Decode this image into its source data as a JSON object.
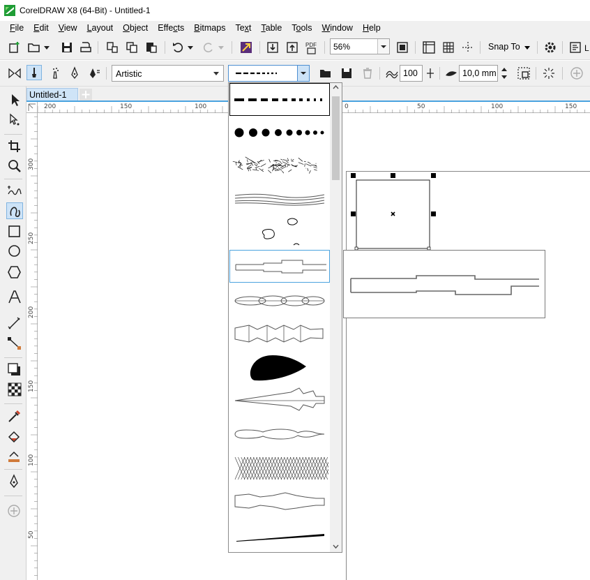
{
  "window": {
    "title": "CorelDRAW X8 (64-Bit) - Untitled-1",
    "brand_color": "#1f9d35"
  },
  "menu": {
    "items": [
      {
        "label": "File",
        "key": "F",
        "rest": "ile"
      },
      {
        "label": "Edit",
        "key": "E",
        "rest": "dit"
      },
      {
        "label": "View",
        "key": "V",
        "rest": "iew"
      },
      {
        "label": "Layout",
        "key": "L",
        "rest": "ayout"
      },
      {
        "label": "Object",
        "key": "O",
        "rest": "bject"
      },
      {
        "label": "Effects",
        "pre": "Effe",
        "key": "c",
        "rest": "ts"
      },
      {
        "label": "Bitmaps",
        "key": "B",
        "rest": "itmaps"
      },
      {
        "label": "Text",
        "pre": "Te",
        "key": "x",
        "rest": "t"
      },
      {
        "label": "Table",
        "key": "T",
        "rest": "able"
      },
      {
        "label": "Tools",
        "pre": "T",
        "key": "o",
        "rest": "ols"
      },
      {
        "label": "Window",
        "key": "W",
        "rest": "indow"
      },
      {
        "label": "Help",
        "key": "H",
        "rest": "elp"
      }
    ]
  },
  "toolbar": {
    "zoom_value": "56%",
    "snap_label": "Snap To",
    "pdf_label": "PDF"
  },
  "property_bar": {
    "mode_select": "Artistic",
    "smoothing_value": "100",
    "width_value": "10,0 mm"
  },
  "document": {
    "tab_label": "Untitled-1"
  },
  "rulers": {
    "horizontal_labels": [
      "200",
      "150",
      "100",
      "0",
      "50",
      "100",
      "150"
    ],
    "vertical_labels": [
      "300",
      "250",
      "200",
      "150",
      "100",
      "50"
    ]
  },
  "stroke_list": {
    "items": [
      "dashed-line",
      "dots",
      "scribble-brush",
      "wavy-lines",
      "blobs",
      "step-line",
      "chain-ovals",
      "bead-shapes",
      "teardrop",
      "arrow-taper",
      "wavy-oval",
      "crosshatch",
      "bumpy-strip",
      "thin-taper"
    ],
    "selected_index": 0,
    "hovered_index": 5
  },
  "colors": {
    "accent": "#4aa3df",
    "selection_handle": "#000000"
  }
}
